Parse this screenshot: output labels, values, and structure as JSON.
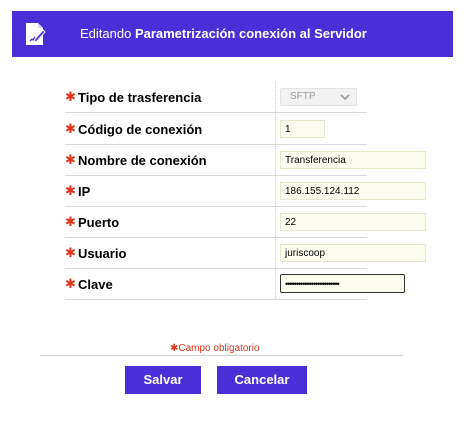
{
  "header": {
    "icon": "edit-document-icon",
    "prefix": "Editando ",
    "title": "Parametrización conexión al Servidor"
  },
  "form": {
    "required_mark": "✱",
    "fields": [
      {
        "label": "Tipo de trasferencia",
        "type": "select",
        "value": "SFTP"
      },
      {
        "label": "Código de conexión",
        "type": "text",
        "value": "1"
      },
      {
        "label": "Nombre de conexión",
        "type": "text",
        "value": "Transferencia"
      },
      {
        "label": "IP",
        "type": "text",
        "value": "186.155.124.112"
      },
      {
        "label": "Puerto",
        "type": "text",
        "value": "22"
      },
      {
        "label": "Usuario",
        "type": "text",
        "value": "juriscoop"
      },
      {
        "label": "Clave",
        "type": "password",
        "value": "•••••••••••••••••••••••••"
      }
    ],
    "required_note": "✱Campo obligatorio"
  },
  "actions": {
    "save_label": "Salvar",
    "cancel_label": "Cancelar"
  },
  "colors": {
    "accent": "#4a2fd8",
    "required": "#e0341c"
  }
}
